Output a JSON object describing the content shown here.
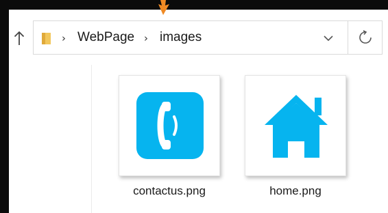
{
  "breadcrumb": {
    "items": [
      "WebPage",
      "images"
    ],
    "separator": "›"
  },
  "files": [
    {
      "name": "contactus.png",
      "icon": "phone-icon"
    },
    {
      "name": "home.png",
      "icon": "home-icon"
    }
  ],
  "colors": {
    "accent_arrow": "#f08a24",
    "thumbnail_blue": "#06b4ef",
    "folder_yellow": "#f2c65a",
    "frame": "#0b0b0b"
  }
}
